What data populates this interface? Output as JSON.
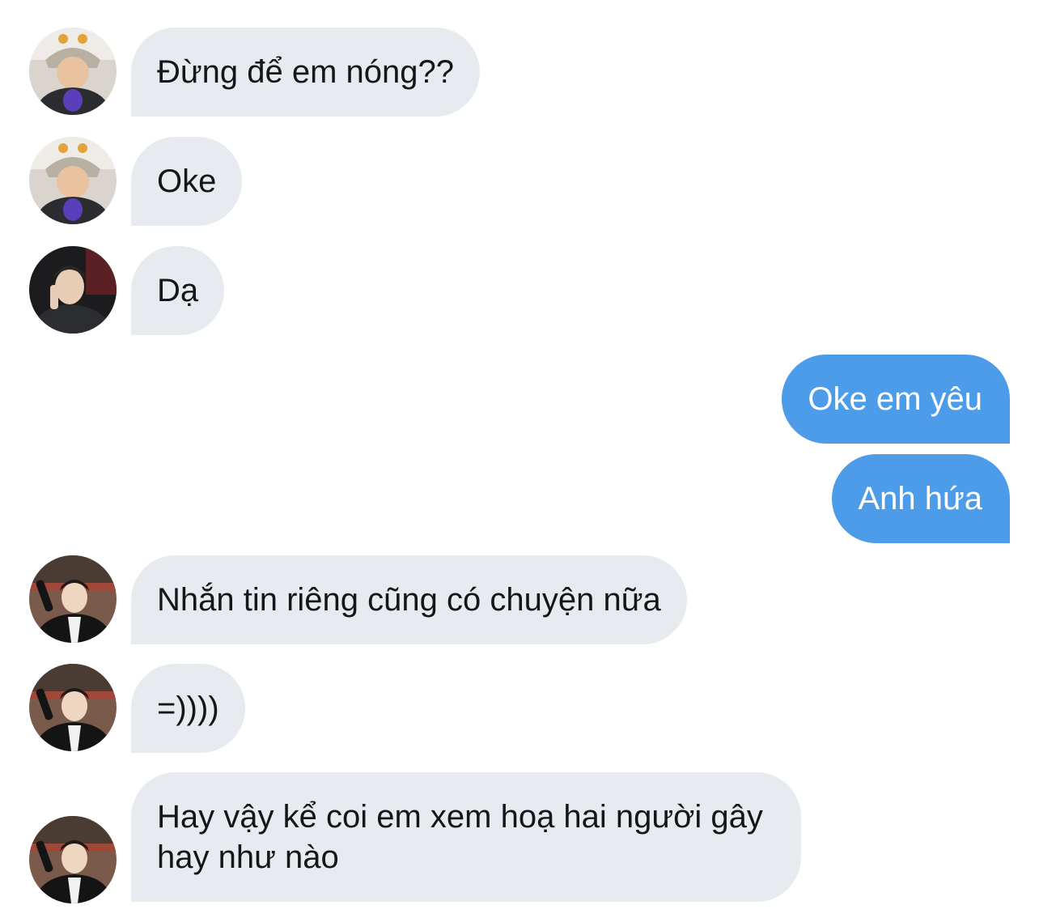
{
  "messages": [
    {
      "side": "in",
      "text": "Đừng để em nóng??",
      "sender_avatar": "avatar-user-a"
    },
    {
      "side": "in",
      "text": "Oke",
      "sender_avatar": "avatar-user-a"
    },
    {
      "side": "in",
      "text": "Dạ",
      "sender_avatar": "avatar-user-b"
    },
    {
      "side": "out",
      "text": "Oke em yêu"
    },
    {
      "side": "out",
      "text": "Anh hứa"
    },
    {
      "side": "in",
      "text": "Nhắn tin riêng cũng có chuyện nữa",
      "sender_avatar": "avatar-user-c"
    },
    {
      "side": "in",
      "text": "=))))",
      "sender_avatar": "avatar-user-c"
    },
    {
      "side": "in",
      "text": "Hay vậy kể coi em xem hoạ hai người gây hay như nào",
      "sender_avatar": "avatar-user-c"
    }
  ],
  "colors": {
    "incoming_bubble": "#e7ebef",
    "outgoing_bubble": "#4d9ce9",
    "incoming_text": "#141619",
    "outgoing_text": "#ffffff"
  }
}
